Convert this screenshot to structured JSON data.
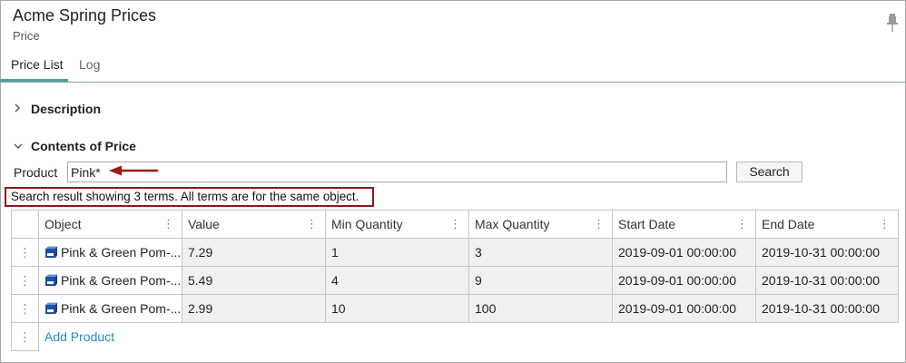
{
  "header": {
    "title": "Acme Spring Prices",
    "subtitle": "Price"
  },
  "tabs": [
    {
      "label": "Price List",
      "active": true
    },
    {
      "label": "Log",
      "active": false
    }
  ],
  "sections": {
    "description": "Description",
    "contents": "Contents of Price"
  },
  "search": {
    "label": "Product",
    "value": "Pink*",
    "button_label": "Search",
    "result_message": "Search result showing 3 terms. All terms are for the same object."
  },
  "table": {
    "columns": [
      "Object",
      "Value",
      "Min Quantity",
      "Max Quantity",
      "Start Date",
      "End Date"
    ],
    "rows": [
      [
        "Pink & Green Pom-...",
        "7.29",
        "1",
        "3",
        "2019-09-01 00:00:00",
        "2019-10-31 00:00:00"
      ],
      [
        "Pink & Green Pom-...",
        "5.49",
        "4",
        "9",
        "2019-09-01 00:00:00",
        "2019-10-31 00:00:00"
      ],
      [
        "Pink & Green Pom-...",
        "2.99",
        "10",
        "100",
        "2019-09-01 00:00:00",
        "2019-10-31 00:00:00"
      ]
    ],
    "add_label": "Add Product"
  },
  "colors": {
    "accent": "#5a9aa0",
    "highlight_border": "#8b1a1a",
    "link": "#1a8bc8",
    "object_icon": "#1f4fa3"
  }
}
